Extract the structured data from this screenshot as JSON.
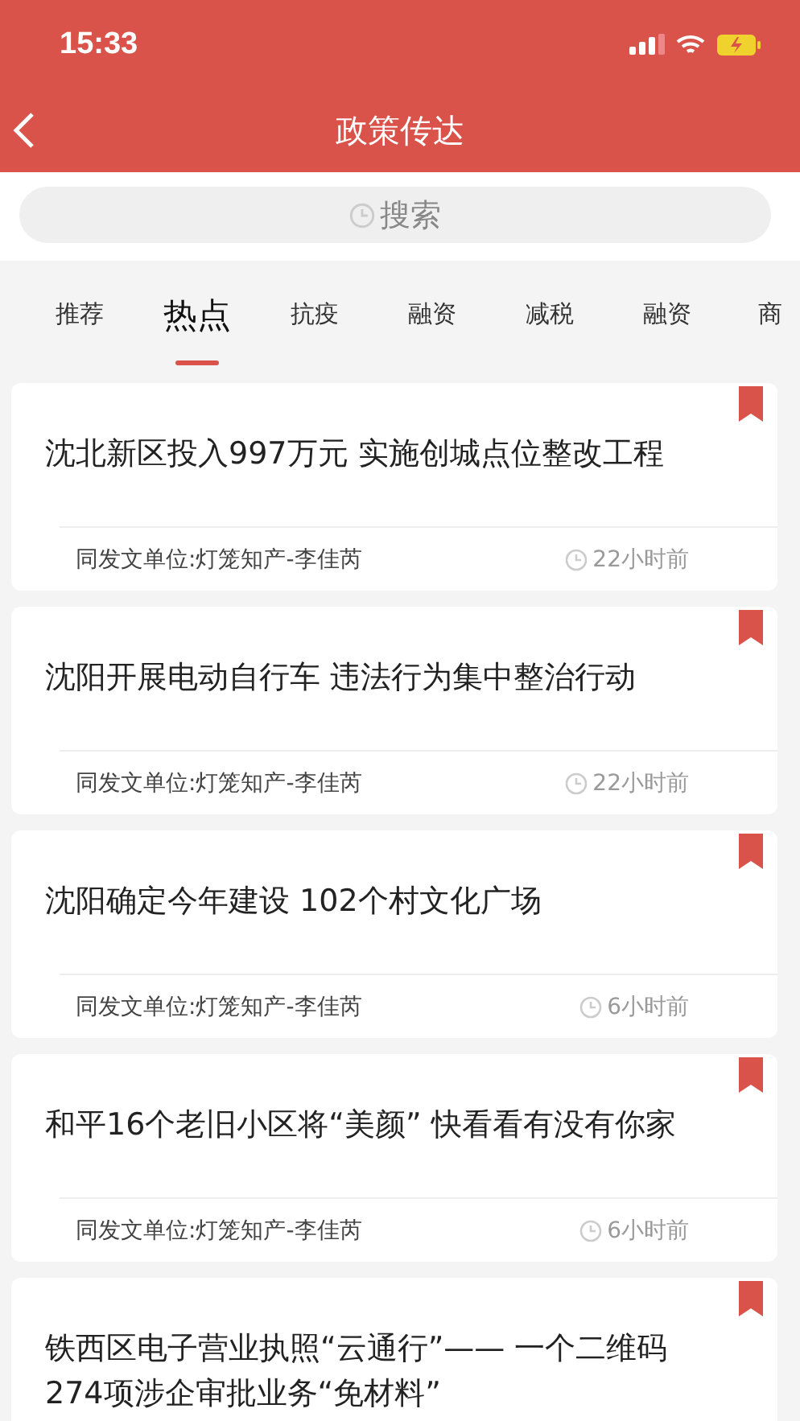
{
  "status_bar": {
    "time": "15:33"
  },
  "nav": {
    "title": "政策传达"
  },
  "search": {
    "placeholder": "搜索"
  },
  "tabs": [
    {
      "label": "推荐",
      "selected": false
    },
    {
      "label": "热点",
      "selected": true
    },
    {
      "label": "抗疫",
      "selected": false
    },
    {
      "label": "融资",
      "selected": false
    },
    {
      "label": "减税",
      "selected": false
    },
    {
      "label": "融资",
      "selected": false
    },
    {
      "label": "商",
      "selected": false
    }
  ],
  "articles": [
    {
      "title": "沈北新区投入997万元 实施创城点位整改工程",
      "source": "同发文单位:灯笼知产-李佳芮",
      "time": "22小时前",
      "bookmarked": true
    },
    {
      "title": "沈阳开展电动自行车 违法行为集中整治行动",
      "source": "同发文单位:灯笼知产-李佳芮",
      "time": "22小时前",
      "bookmarked": true
    },
    {
      "title": "沈阳确定今年建设 102个村文化广场",
      "source": "同发文单位:灯笼知产-李佳芮",
      "time": "6小时前",
      "bookmarked": true
    },
    {
      "title": "和平16个老旧小区将“美颜” 快看看有没有你家",
      "source": "同发文单位:灯笼知产-李佳芮",
      "time": "6小时前",
      "bookmarked": true
    },
    {
      "title": "铁西区电子营业执照“云通行”—— 一个二维码274项涉企审批业务“免材料”",
      "bookmarked": true
    }
  ]
}
